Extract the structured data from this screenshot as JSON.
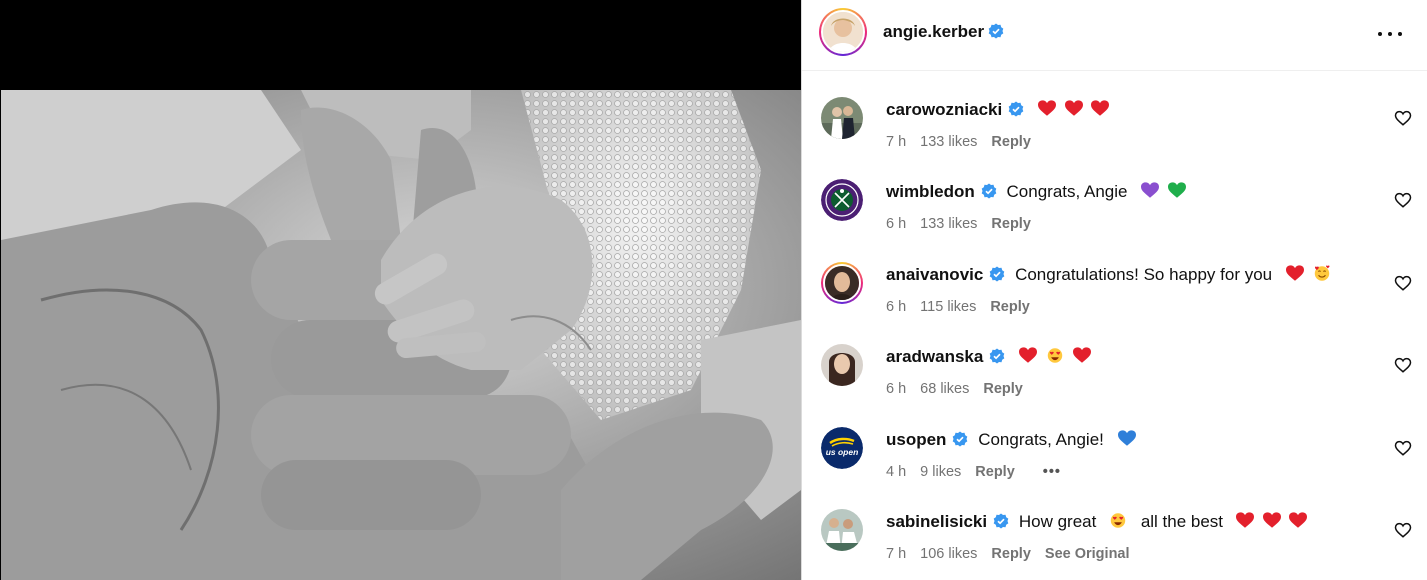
{
  "post": {
    "author": "angie.kerber",
    "author_verified": true,
    "more_icon": "more-horizontal-icon"
  },
  "comments": [
    {
      "username": "carowozniacki",
      "verified": true,
      "text": "",
      "emojis": [
        "heart-red",
        "heart-red",
        "heart-red"
      ],
      "time": "7 h",
      "likes": "133 likes",
      "reply": "Reply"
    },
    {
      "username": "wimbledon",
      "verified": true,
      "text": "Congrats, Angie",
      "emojis": [
        "heart-purple",
        "heart-green"
      ],
      "time": "6 h",
      "likes": "133 likes",
      "reply": "Reply"
    },
    {
      "username": "anaivanovic",
      "verified": true,
      "text": "Congratulations! So happy for you",
      "emojis": [
        "heart-red",
        "smiling-face-with-hearts"
      ],
      "time": "6 h",
      "likes": "115 likes",
      "reply": "Reply"
    },
    {
      "username": "aradwanska",
      "verified": true,
      "text": "",
      "emojis": [
        "heart-red",
        "heart-eyes",
        "heart-red"
      ],
      "time": "6 h",
      "likes": "68 likes",
      "reply": "Reply"
    },
    {
      "username": "usopen",
      "verified": true,
      "text": "Congrats, Angie!",
      "emojis": [
        "heart-blue"
      ],
      "time": "4 h",
      "likes": "9 likes",
      "reply": "Reply",
      "more": "•••"
    },
    {
      "username": "sabinelisicki",
      "verified": true,
      "text": "How great",
      "emojis": [
        "heart-eyes"
      ],
      "text_after": "all the best",
      "emojis_after": [
        "heart-red",
        "heart-red",
        "heart-red"
      ],
      "time": "7 h",
      "likes": "106 likes",
      "reply": "Reply",
      "see_original": "See Original"
    }
  ],
  "avatar_text": {
    "usopen": "us open"
  },
  "colors": {
    "verified_blue": "#3897f0",
    "meta_gray": "#737373",
    "heart_red": "#e0245e",
    "wimbledon_purple": "#4b1f73",
    "usopen_navy": "#0a2a6b",
    "usopen_yellow": "#ffd200"
  }
}
